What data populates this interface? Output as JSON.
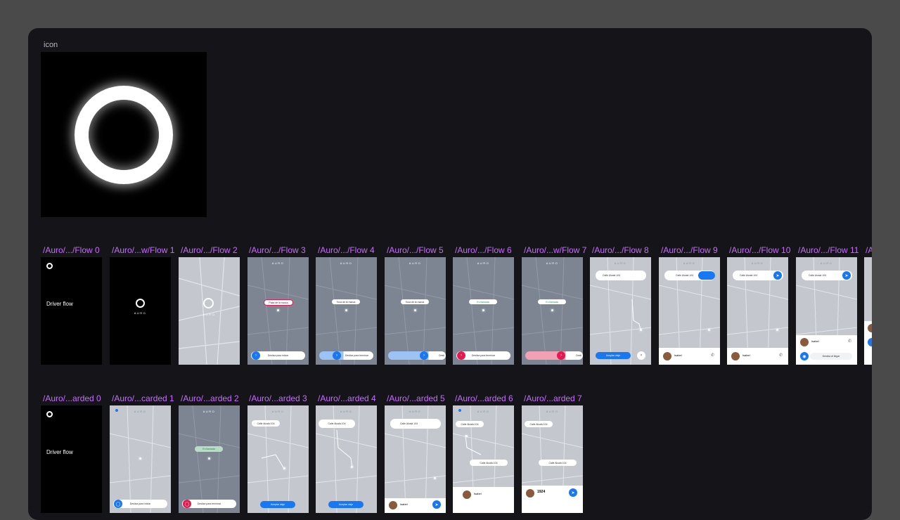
{
  "icon_section": {
    "label": "icon"
  },
  "row1": {
    "labels": [
      "/Auro/.../Flow 0",
      "/Auro/...w/Flow 1",
      "/Auro/.../Flow 2",
      "/Auro/.../Flow 3",
      "/Auro/.../Flow 4",
      "/Auro/.../Flow 5",
      "/Auro/.../Flow 6",
      "/Auro/...w/Flow 7",
      "/Auro/.../Flow 8",
      "/Auro/.../Flow 9",
      "/Auro/.../Flow 10",
      "/Auro/.../Flow 11",
      "/A"
    ]
  },
  "row2": {
    "labels": [
      "/Auro/...arded 0",
      "/Auro/...carded 1",
      "/Auro/...arded 2",
      "/Auro/...arded 3",
      "/Auro/...arded 4",
      "/Auro/...arded 5",
      "/Auro/...arded 6",
      "/Auro/...arded 7"
    ]
  },
  "frames": {
    "driver_flow": "Driver flow",
    "brand": "AURO",
    "slide_start": "Desliza para iniciar",
    "slide_finish": "Desliza para terminar",
    "slide_short": "Desli",
    "accept_trip": "Aceptar viaje",
    "slide_arrive": "Desliza al llegar",
    "address": "Calle Alcalá 104",
    "rider_name": "Isabel",
    "code": "1924",
    "badge_red": "Pasa de la marca",
    "badge_white": "Toca de la marca",
    "badge_green": "En llamada"
  },
  "colors": {
    "accent_purple": "#c86cff",
    "blue": "#1877f2",
    "red": "#e5184f",
    "pink": "#f2a0b4"
  }
}
